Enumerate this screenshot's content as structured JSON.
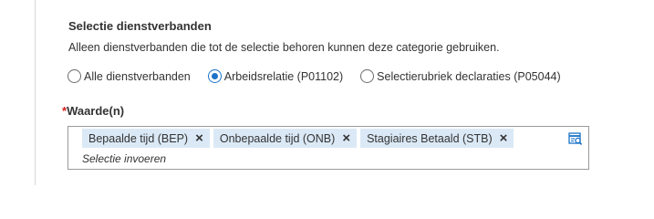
{
  "section": {
    "title": "Selectie dienstverbanden",
    "description": "Alleen dienstverbanden die tot de selectie behoren kunnen deze categorie gebruiken."
  },
  "radio_options": [
    {
      "label": "Alle dienstverbanden",
      "checked": false
    },
    {
      "label": "Arbeidsrelatie (P01102)",
      "checked": true
    },
    {
      "label": "Selectierubriek declaraties (P05044)",
      "checked": false
    }
  ],
  "field": {
    "required_marker": "*",
    "label": "Waarde(n)",
    "chips": [
      {
        "label": "Bepaalde tijd (BEP)",
        "remove_icon": "×"
      },
      {
        "label": "Onbepaalde tijd (ONB)",
        "remove_icon": "×"
      },
      {
        "label": "Stagiaires Betaald (STB)",
        "remove_icon": "×"
      }
    ],
    "placeholder": "Selectie invoeren",
    "lookup_icon": "list-search-icon"
  },
  "colors": {
    "accent": "#1a73c7",
    "chip_background": "#dbe9f6",
    "required": "#d42020"
  }
}
